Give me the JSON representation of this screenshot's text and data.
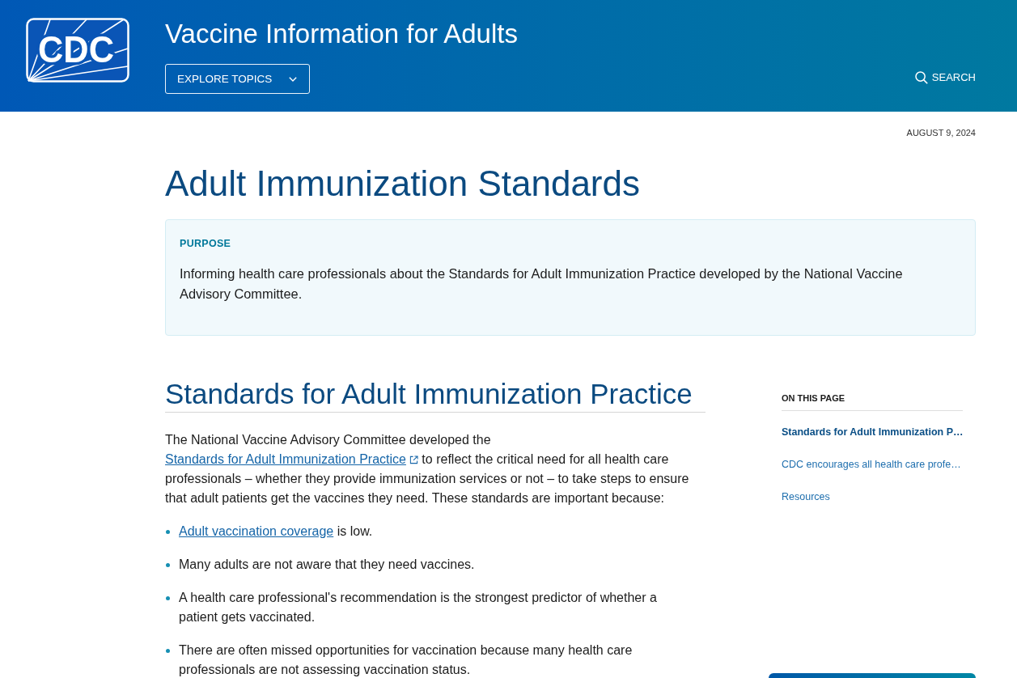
{
  "header": {
    "logo_text": "CDC",
    "title": "Vaccine Information for Adults",
    "explore_button": "EXPLORE TOPICS",
    "search_button": "SEARCH"
  },
  "date": "AUGUST 9, 2024",
  "page_title": "Adult Immunization Standards",
  "purpose": {
    "label": "PURPOSE",
    "text": "Informing health care professionals about the Standards for Adult Immunization Practice developed by the National Vaccine Advisory Committee."
  },
  "section": {
    "heading": "Standards for Adult Immunization Practice",
    "intro": [
      {
        "kind": "text",
        "text": "The National Vaccine Advisory Committee developed the "
      },
      {
        "kind": "external_link",
        "text": "Standards for Adult Immunization Practice"
      },
      {
        "kind": "text",
        "text": " to reflect the critical need for all health care professionals – whether they provide immunization services or not – to take steps to ensure that adult patients get the vaccines they need. These standards are important because:"
      }
    ],
    "bullets": [
      {
        "parts": [
          {
            "kind": "link",
            "text": "Adult vaccination coverage"
          },
          {
            "kind": "text",
            "text": " is low."
          }
        ]
      },
      {
        "parts": [
          {
            "kind": "text",
            "text": "Many adults are not aware that they need vaccines."
          }
        ]
      },
      {
        "parts": [
          {
            "kind": "text",
            "text": "A health care professional's recommendation is the strongest predictor of whether a patient gets vaccinated."
          }
        ]
      },
      {
        "parts": [
          {
            "kind": "text",
            "text": "There are often missed opportunities for vaccination because many health care professionals are not assessing vaccination status."
          }
        ]
      }
    ]
  },
  "on_this_page": {
    "heading": "ON THIS PAGE",
    "items": [
      {
        "label": "Standards for Adult Immunization P…",
        "selected": true
      },
      {
        "label": "CDC encourages all health care profe…",
        "selected": false
      },
      {
        "label": "Resources",
        "selected": false
      }
    ]
  }
}
